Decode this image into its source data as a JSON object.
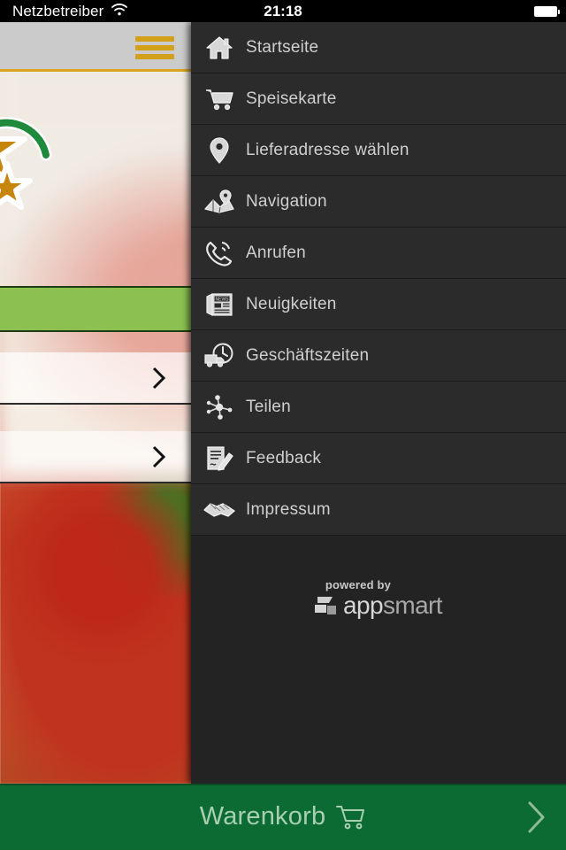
{
  "status_bar": {
    "carrier": "Netzbetreiber",
    "wifi_icon": "wifi-icon",
    "time": "21:18",
    "battery_icon": "battery-full-icon"
  },
  "app": {
    "menu_button_icon": "hamburger-menu-icon",
    "logo_icon": "star-logo-icon",
    "row_chevron_icon": "chevron-right-icon",
    "accent_gold": "#d2a01b",
    "accent_green": "#8cc152",
    "topbar_bg": "#cbcbcb"
  },
  "drawer": {
    "background": "#2b2b2b",
    "items": [
      {
        "label": "Startseite",
        "icon": "home-icon"
      },
      {
        "label": "Speisekarte",
        "icon": "shopping-cart-icon"
      },
      {
        "label": "Lieferadresse wählen",
        "icon": "map-pin-icon"
      },
      {
        "label": "Navigation",
        "icon": "map-navigation-icon"
      },
      {
        "label": "Anrufen",
        "icon": "phone-call-icon"
      },
      {
        "label": "Neuigkeiten",
        "icon": "newspaper-icon"
      },
      {
        "label": "Geschäftszeiten",
        "icon": "delivery-clock-icon"
      },
      {
        "label": "Teilen",
        "icon": "share-nodes-icon"
      },
      {
        "label": "Feedback",
        "icon": "form-pencil-icon"
      },
      {
        "label": "Impressum",
        "icon": "handshake-icon"
      }
    ],
    "footer": {
      "powered_by": "powered by",
      "brand_first": "app",
      "brand_second": "smart",
      "logo_icon": "appsmart-logo-icon"
    }
  },
  "cart_bar": {
    "label": "Warenkorb",
    "cart_icon": "shopping-cart-outline-icon",
    "chevron_icon": "chevron-right-icon",
    "background": "#0b6b33",
    "text_color": "#a8cfb1"
  }
}
